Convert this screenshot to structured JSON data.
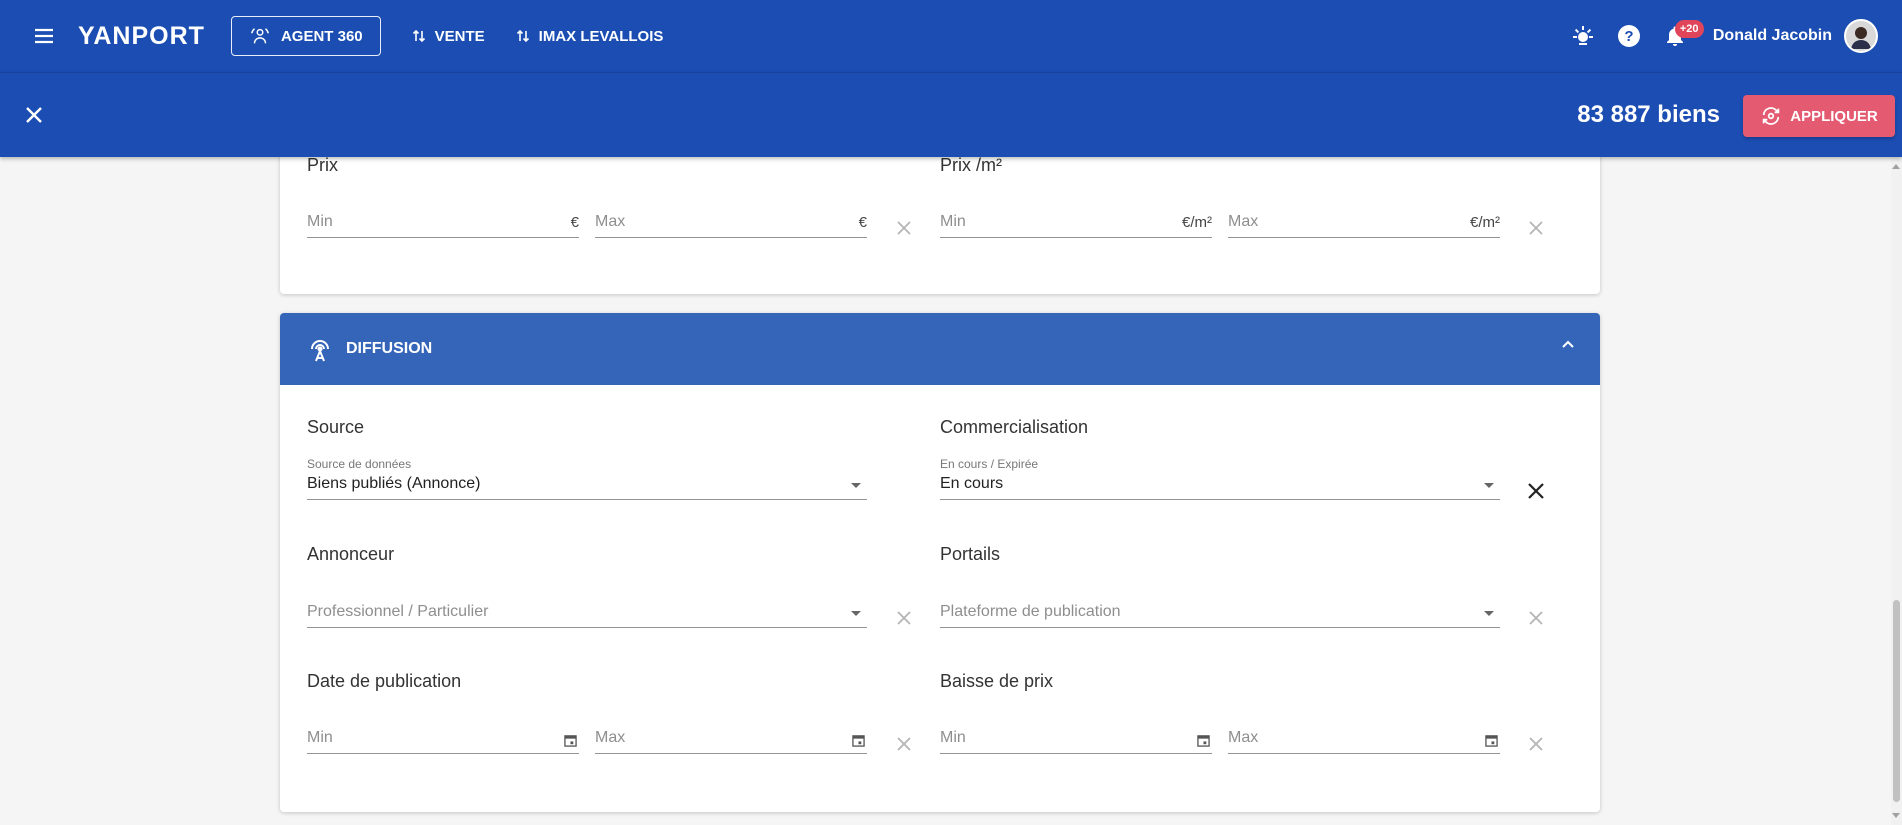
{
  "header": {
    "logo": "YANPORT",
    "agent_button": "AGENT 360",
    "nav": [
      "VENTE",
      "IMAX LEVALLOIS"
    ],
    "notification_count": "+20",
    "user_name": "Donald Jacobin"
  },
  "filter_bar": {
    "count": "83 887 biens",
    "apply_label": "APPLIQUER"
  },
  "price": {
    "prix_label": "Prix",
    "prix_min": "Min",
    "prix_max": "Max",
    "prix_unit": "€",
    "prix_m2_label": "Prix /m²",
    "prix_m2_min": "Min",
    "prix_m2_max": "Max",
    "prix_m2_unit": "€/m²"
  },
  "diffusion": {
    "title": "DIFFUSION",
    "source": {
      "label": "Source",
      "small_label": "Source de données",
      "value": "Biens publiés (Annonce)"
    },
    "commercialisation": {
      "label": "Commercialisation",
      "small_label": "En cours / Expirée",
      "value": "En cours"
    },
    "annonceur": {
      "label": "Annonceur",
      "placeholder": "Professionnel / Particulier"
    },
    "portails": {
      "label": "Portails",
      "placeholder": "Plateforme de publication"
    },
    "date_publication": {
      "label": "Date de publication",
      "min": "Min",
      "max": "Max"
    },
    "baisse_prix": {
      "label": "Baisse de prix",
      "min": "Min",
      "max": "Max"
    }
  },
  "colors": {
    "header_bg": "#1b4db3",
    "section_header_bg": "#3565b9",
    "apply_button": "#e45a70"
  },
  "icons": [
    "menu-icon",
    "agent-icon",
    "swap-icon",
    "bulb-icon",
    "help-icon",
    "bell-icon",
    "close-icon",
    "refresh-icon",
    "antenna-icon",
    "chevron-up-icon",
    "calendar-icon"
  ]
}
